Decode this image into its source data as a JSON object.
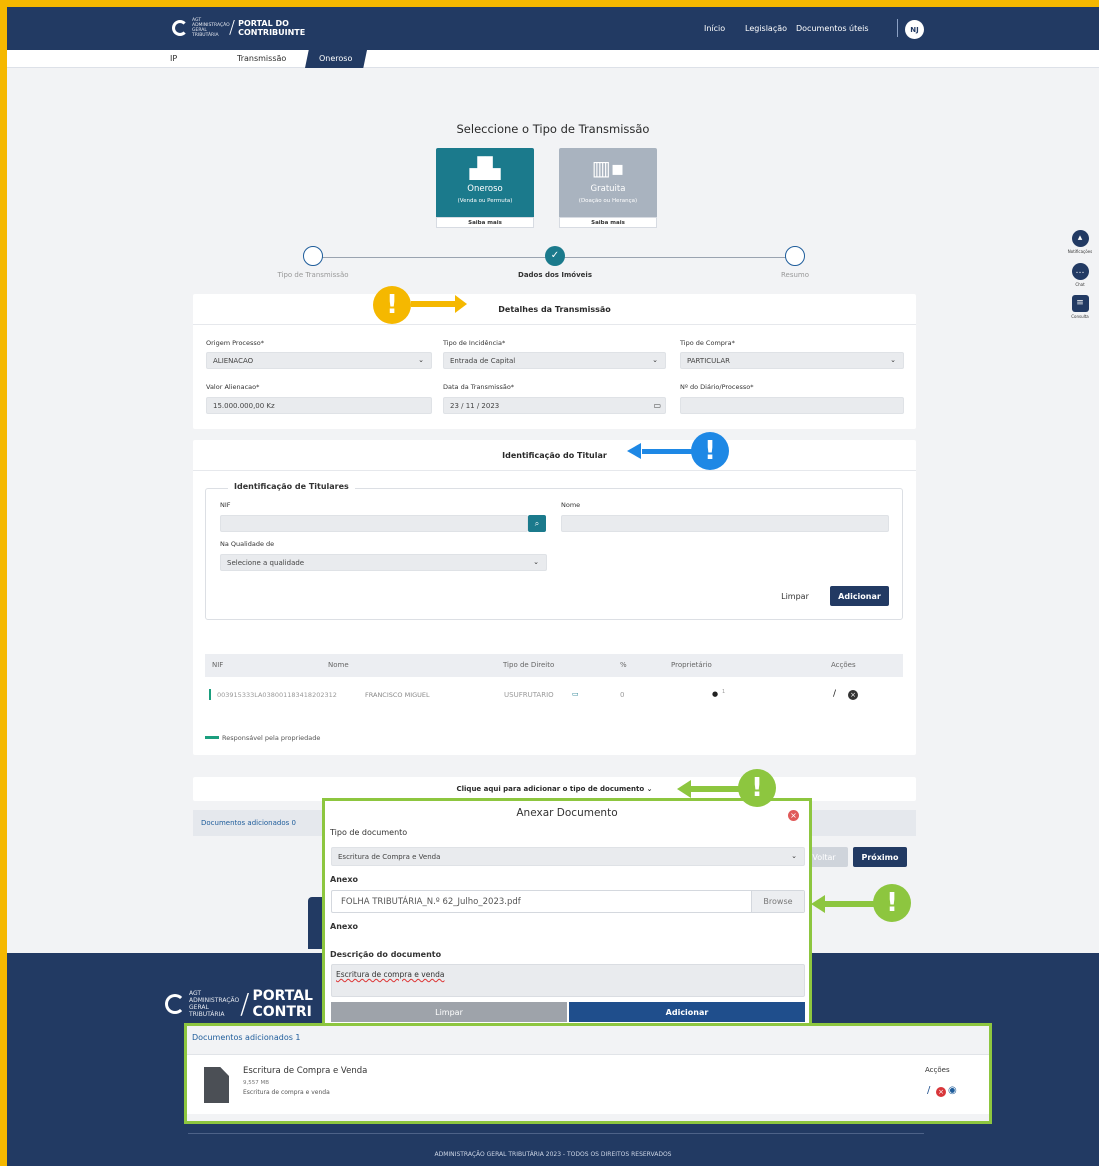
{
  "header": {
    "logo_small": "AGT ADMINISTRAÇÃO GERAL TRIBUTÁRIA",
    "logo_title_line1": "PORTAL DO",
    "logo_title_line2": "CONTRIBUINTE",
    "nav": [
      "Início",
      "Legislação",
      "Documentos úteis"
    ],
    "avatar": "NJ"
  },
  "breadcrumbs": [
    "IP",
    "Transmissão",
    "Oneroso"
  ],
  "page_title": "Seleccione o Tipo de Transmissão",
  "transmission_cards": [
    {
      "title": "Oneroso",
      "subtitle": "(Venda ou Permuta)",
      "more": "Saiba mais",
      "color": "#1b7a8c"
    },
    {
      "title": "Gratuita",
      "subtitle": "(Doação ou Herança)",
      "more": "Saiba mais",
      "color": "#a9b3bf"
    }
  ],
  "steps": [
    "Tipo de Transmissão",
    "Dados dos Imóveis",
    "Resumo"
  ],
  "detalhes": {
    "title": "Detalhes da Transmissão",
    "origem_label": "Origem Processo*",
    "origem_value": "ALIENACAO",
    "incidencia_label": "Tipo de Incidência*",
    "incidencia_value": "Entrada de Capital",
    "compra_label": "Tipo de Compra*",
    "compra_value": "PARTICULAR",
    "valor_label": "Valor Alienacao*",
    "valor_value": "15.000.000,00 Kz",
    "data_label": "Data da Transmissão*",
    "data_value": "23 / 11 / 2023",
    "diario_label": "Nº do Diário/Processo*",
    "diario_value": ""
  },
  "titular": {
    "title": "Identificação do Titular",
    "legend": "Identificação de Titulares",
    "nif_label": "NIF",
    "nome_label": "Nome",
    "qualidade_label": "Na Qualidade de",
    "qualidade_value": "Selecione a qualidade",
    "clear": "Limpar",
    "add": "Adicionar",
    "table_headers": [
      "NIF",
      "Nome",
      "Tipo de Direito",
      "%",
      "Proprietário",
      "Acções"
    ],
    "row": {
      "nif": "003915333LA038001183418202312",
      "nome": "FRANCISCO MIGUEL",
      "direito": "USUFRUTARIO",
      "percent": "0",
      "prop": "1"
    },
    "legend_note": "Responsável pela propriedade"
  },
  "documentos": {
    "toggle": "Clique aqui para adicionar o tipo de documento",
    "added_label": "Documentos adicionados 0",
    "back": "Voltar",
    "next": "Próximo"
  },
  "modal": {
    "title": "Anexar Documento",
    "tipo_label": "Tipo de documento",
    "tipo_value": "Escritura de Compra e Venda",
    "anexo_label": "Anexo",
    "file_name": "FOLHA TRIBUTÁRIA_N.º 62_Julho_2023.pdf",
    "browse": "Browse",
    "anexo_label2": "Anexo",
    "descricao_label": "Descrição do documento",
    "descricao_value": "Escritura de compra e venda",
    "clear": "Limpar",
    "add": "Adicionar"
  },
  "added_docs": {
    "title": "Documentos adicionados 1",
    "actions_header": "Acções",
    "doc_name": "Escritura de Compra e Venda",
    "doc_size": "9,557 MB",
    "doc_desc": "Escritura de compra e venda"
  },
  "side_tools": [
    "Notificações",
    "Chat",
    "Consulta"
  ],
  "footer": {
    "logo_small": "AGT ADMINISTRAÇÃO GERAL TRIBUTÁRIA",
    "title1": "PORTAL",
    "title2": "CONTRI",
    "copyright": "ADMINISTRAÇÃO GERAL TRIBUTÁRIA 2023 - TODOS OS DIREITOS RESERVADOS"
  },
  "colors": {
    "navy": "#223a63",
    "teal": "#1b7a8c",
    "green_callout": "#8dc63f",
    "yellow_callout": "#f5b800",
    "blue_callout": "#1e88e5"
  }
}
